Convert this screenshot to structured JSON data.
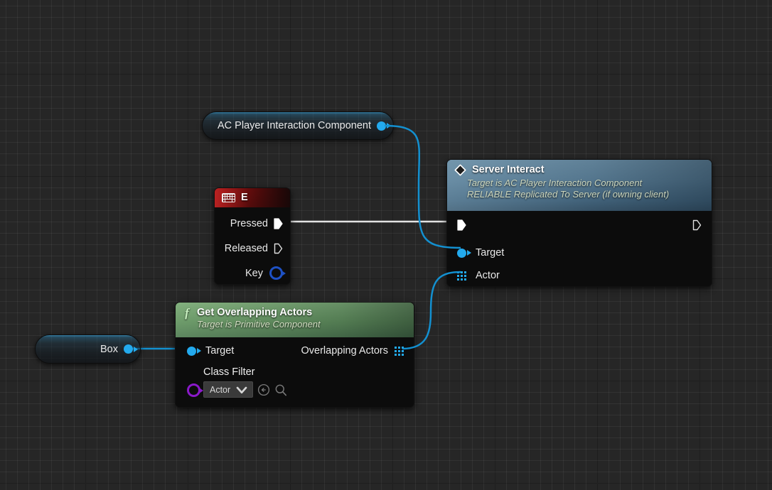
{
  "graph": {
    "app": "Unreal Engine Blueprint Graph",
    "background_color": "#262626",
    "grid_minor_color": "#333333",
    "grid_major_color": "#1b1b1b"
  },
  "nodes": {
    "component_ref": {
      "title": "AC Player Interaction Component",
      "kind": "component-variable-get",
      "pin_color": "#23aaee",
      "output_pin_name": "component-out"
    },
    "box_ref": {
      "title": "Box",
      "kind": "component-variable-get",
      "pin_color": "#23aaee",
      "output_pin_name": "box-out"
    },
    "key_event": {
      "title": "E",
      "icon": "keyboard-icon",
      "header_color": "#a81d1d",
      "pins": [
        {
          "label": "Pressed",
          "type": "exec",
          "filled": true
        },
        {
          "label": "Released",
          "type": "exec",
          "filled": false
        },
        {
          "label": "Key",
          "type": "data",
          "color": "#1e51c4"
        }
      ]
    },
    "get_overlapping_actors": {
      "title": "Get Overlapping Actors",
      "subtitle": "Target is Primitive Component",
      "icon": "function-f-icon",
      "header_color": "#5e8a5c",
      "inputs": [
        {
          "label": "Target",
          "type": "object",
          "color": "#23aaee"
        },
        {
          "label": "Class Filter",
          "type": "class",
          "color": "#8a19c9"
        }
      ],
      "outputs": [
        {
          "label": "Overlapping Actors",
          "type": "array",
          "color": "#23aaee"
        }
      ],
      "class_filter": {
        "value": "Actor",
        "dropdown_icon": "chevron-down-icon",
        "browse_icon": "browse-back-icon",
        "search_icon": "search-icon"
      }
    },
    "server_interact": {
      "title": "Server Interact",
      "subtitle": "Target is AC Player Interaction Component\nRELIABLE Replicated To Server (if owning client)",
      "icon": "diamond-event-icon",
      "header_color": "#4f7288",
      "inputs": [
        {
          "label": "",
          "type": "exec",
          "filled": true
        },
        {
          "label": "Target",
          "type": "object",
          "color": "#23aaee"
        },
        {
          "label": "Actor",
          "type": "array",
          "color": "#23aaee"
        }
      ],
      "outputs": [
        {
          "label": "",
          "type": "exec",
          "filled": false
        }
      ]
    }
  },
  "wires": [
    {
      "name": "component-to-target",
      "color": "#1390d0",
      "from": "AC Player Interaction Component",
      "to": "Server Interact / Target"
    },
    {
      "name": "pressed-to-exec",
      "color": "#e8e8e8",
      "from": "E / Pressed",
      "to": "Server Interact / exec-in"
    },
    {
      "name": "box-to-target",
      "color": "#1390d0",
      "from": "Box",
      "to": "Get Overlapping Actors / Target"
    },
    {
      "name": "overlapping-to-actor",
      "color": "#1390d0",
      "from": "Get Overlapping Actors / Overlapping Actors",
      "to": "Server Interact / Actor"
    }
  ]
}
